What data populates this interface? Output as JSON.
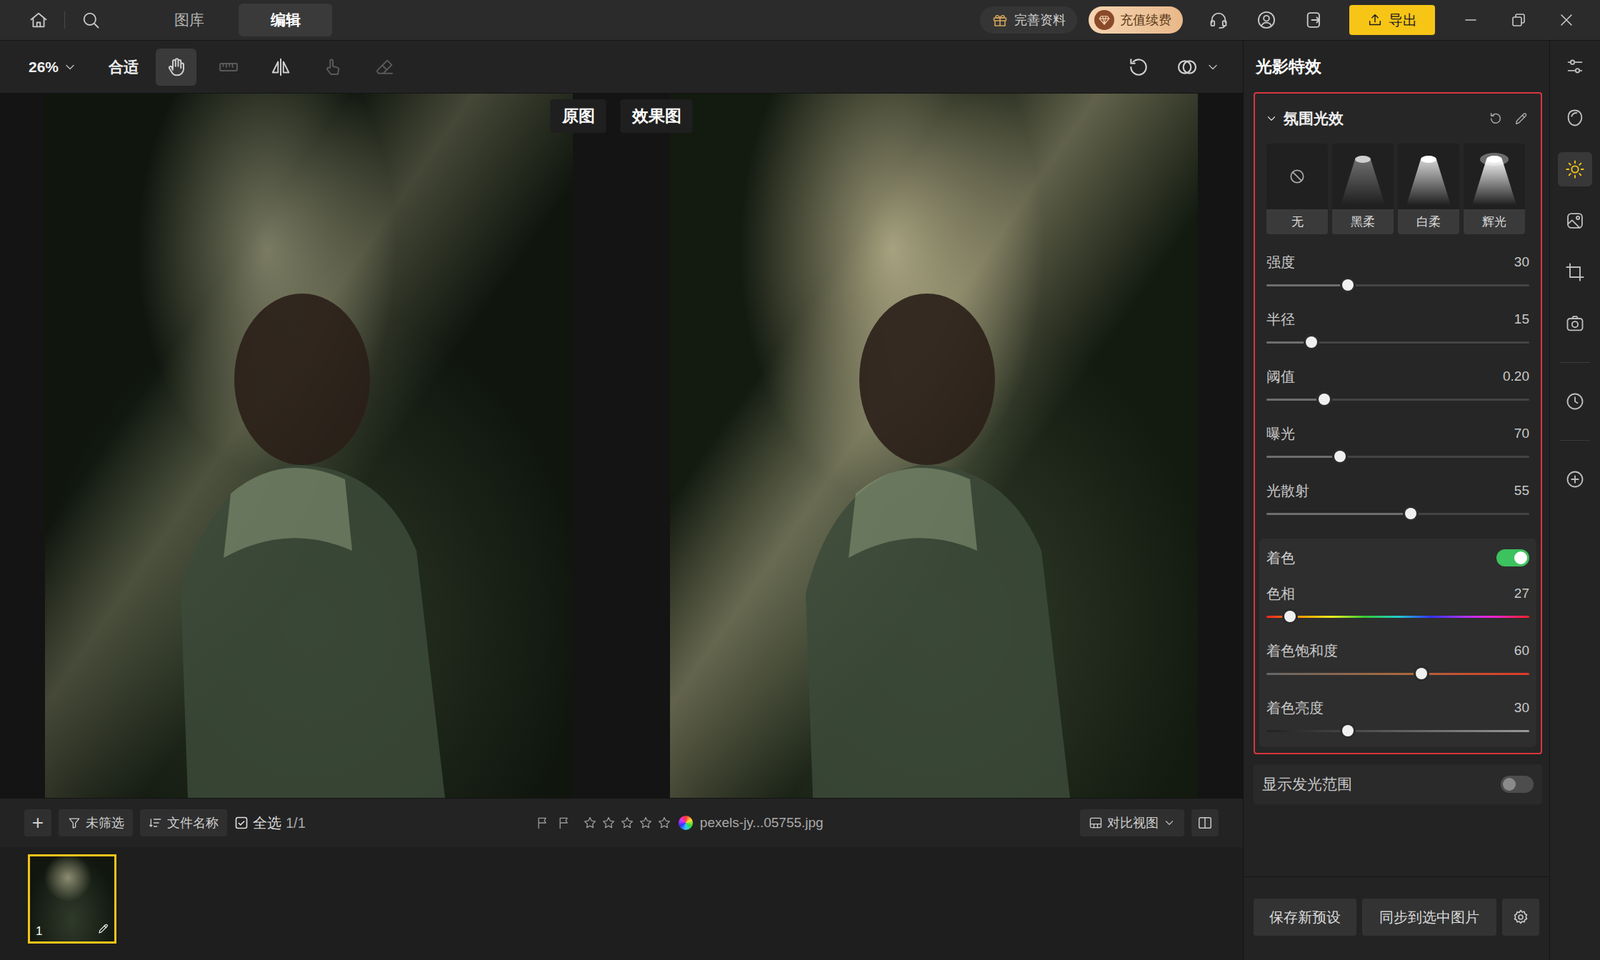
{
  "topbar": {
    "tabs": [
      {
        "label": "图库",
        "selected": false
      },
      {
        "label": "编辑",
        "selected": true
      }
    ],
    "profile_button": "完善资料",
    "recharge_button": "充值续费",
    "export_button": "导出"
  },
  "toolbar": {
    "zoom": "26%",
    "fit": "合适",
    "tools": [
      {
        "selected": true,
        "disabled": false
      },
      {
        "selected": false,
        "disabled": true
      },
      {
        "selected": false,
        "disabled": false
      },
      {
        "selected": false,
        "disabled": true
      },
      {
        "selected": false,
        "disabled": true
      }
    ]
  },
  "canvas": {
    "views": [
      {
        "label": "原图",
        "kind": "original"
      },
      {
        "label": "效果图",
        "kind": "effect"
      }
    ]
  },
  "filmstrip": {
    "add": "+",
    "filter": "未筛选",
    "sort": "文件名称",
    "select_all": {
      "label": "全选",
      "checked": true
    },
    "count": "1/1",
    "stars": 0,
    "filename": "pexels-jy...05755.jpg",
    "view_mode": "对比视图",
    "thumbnails": [
      {
        "number": "1",
        "selected": true
      }
    ]
  },
  "panel": {
    "title": "光影特效",
    "section": {
      "title": "氛围光效",
      "expanded": true,
      "presets": [
        {
          "label": "无",
          "kind": "none",
          "selected": false
        },
        {
          "label": "黑柔",
          "kind": "black",
          "selected": false
        },
        {
          "label": "白柔",
          "kind": "white",
          "selected": false
        },
        {
          "label": "辉光",
          "kind": "glow",
          "selected": false
        }
      ],
      "sliders": [
        {
          "label": "强度",
          "value": "30",
          "level": 0.31
        },
        {
          "label": "半径",
          "value": "15",
          "level": 0.17
        },
        {
          "label": "阈值",
          "value": "0.20",
          "level": 0.22
        },
        {
          "label": "曝光",
          "value": "70",
          "level": 0.28
        },
        {
          "label": "光散射",
          "value": "55",
          "level": 0.55
        }
      ],
      "tint": {
        "label": "着色",
        "on": true,
        "sliders": [
          {
            "label": "色相",
            "value": "27",
            "level": 0.09,
            "kind": "hue"
          },
          {
            "label": "着色饱和度",
            "value": "60",
            "level": 0.59,
            "kind": "saturation"
          },
          {
            "label": "着色亮度",
            "value": "30",
            "level": 0.31,
            "kind": "brightness"
          }
        ]
      }
    },
    "show_range": {
      "label": "显示发光范围",
      "on": false
    },
    "save_preset": "保存新预设",
    "sync": "同步到选中图片"
  },
  "rail": [
    {
      "selected": false
    },
    {
      "selected": false
    },
    {
      "selected": true
    },
    {
      "selected": false
    },
    {
      "selected": false
    },
    {
      "selected": false
    },
    {
      "selected": false
    },
    {
      "selected": false
    }
  ]
}
